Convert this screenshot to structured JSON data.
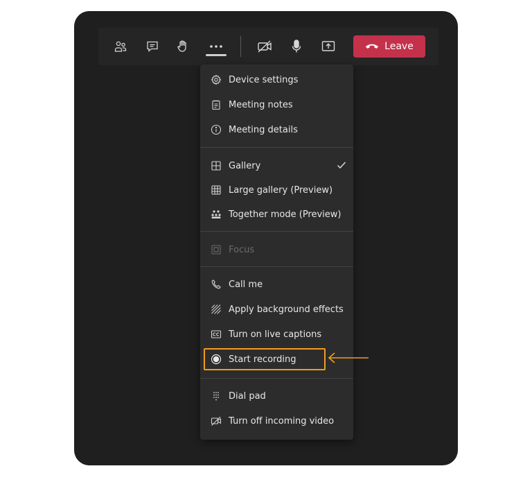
{
  "toolbar": {
    "leave_label": "Leave",
    "buttons": [
      {
        "name": "participants",
        "icon": "people-icon"
      },
      {
        "name": "chat",
        "icon": "chat-icon"
      },
      {
        "name": "raise-hand",
        "icon": "hand-icon"
      },
      {
        "name": "more-actions",
        "icon": "more-icon"
      },
      {
        "name": "camera",
        "icon": "camera-off-icon"
      },
      {
        "name": "microphone",
        "icon": "mic-icon"
      },
      {
        "name": "share",
        "icon": "share-tray-icon"
      }
    ]
  },
  "menu": {
    "items": [
      {
        "label": "Device settings",
        "icon": "gear-icon"
      },
      {
        "label": "Meeting notes",
        "icon": "notes-icon"
      },
      {
        "label": "Meeting details",
        "icon": "info-icon"
      },
      {
        "label": "Gallery",
        "icon": "gallery-icon",
        "checked": true
      },
      {
        "label": "Large gallery (Preview)",
        "icon": "large-gallery-icon"
      },
      {
        "label": "Together mode (Preview)",
        "icon": "together-mode-icon"
      },
      {
        "label": "Focus",
        "icon": "focus-icon",
        "disabled": true
      },
      {
        "label": "Call me",
        "icon": "phone-icon"
      },
      {
        "label": "Apply background effects",
        "icon": "background-effects-icon"
      },
      {
        "label": "Turn on live captions",
        "icon": "captions-icon"
      },
      {
        "label": "Start recording",
        "icon": "record-icon",
        "highlighted": true
      },
      {
        "label": "Dial pad",
        "icon": "dialpad-icon"
      },
      {
        "label": "Turn off incoming video",
        "icon": "video-off-icon"
      }
    ]
  },
  "colors": {
    "window_bg": "#1f1f1f",
    "menu_bg": "#2d2c2c",
    "leave_button": "#c4314b",
    "highlight": "#f39c1e"
  }
}
